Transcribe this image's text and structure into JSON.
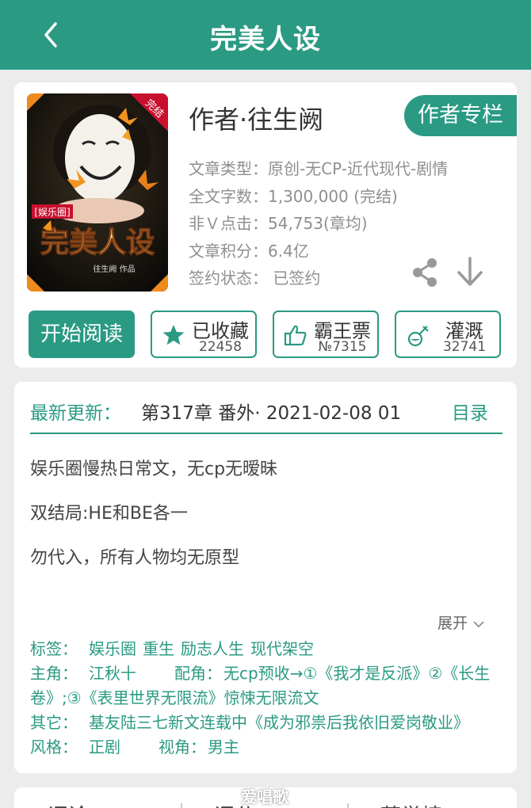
{
  "header": {
    "back_icon": "chevron-left-icon",
    "title": "完美人设"
  },
  "colors": {
    "accent": "#2a9a83",
    "background": "#ececec"
  },
  "book": {
    "cover": {
      "badge": "完结",
      "tag": "[娱乐圈]",
      "title_art": "完美人设",
      "author_line": "往生阙 作品"
    },
    "author": "作者·往生阙",
    "author_column_button": "作者专栏",
    "meta": [
      "文章类型：原创-无CP-近代现代-剧情",
      "全文字数：1,300,000 (完结)",
      "非Ｖ点击：54,753(章均)",
      "文章积分：6.4亿",
      "签约状态：  已签约"
    ],
    "share_icon": "share-icon",
    "download_icon": "download-icon"
  },
  "actions": {
    "read_button": "开始阅读",
    "favorite": {
      "icon": "star-icon",
      "label": "已收藏",
      "count": "22458"
    },
    "bawang": {
      "icon": "thumbs-up-icon",
      "label": "霸王票",
      "count": "№7315"
    },
    "irrigate": {
      "icon": "watering-icon",
      "label": "灌溉",
      "count": "32741"
    }
  },
  "update": {
    "label": "最新更新：",
    "text": "第317章  番外·  2021-02-08 01",
    "toc_link": "目录"
  },
  "description": [
    "娱乐圈慢热日常文，无cp无暧昧",
    "双结局:HE和BE各一",
    "勿代入，所有人物均无原型"
  ],
  "expand": "展开",
  "tags": {
    "label": "标签：",
    "items": [
      "娱乐圈",
      "重生",
      "励志人生",
      "现代架空"
    ]
  },
  "roles": {
    "main_label": "主角：",
    "main": "江秋十",
    "support_label": "配角：",
    "support": "无cp预收→①《我才是反派》②《长生卷》;③《表里世界无限流》惊悚无限流文"
  },
  "other": {
    "label": "其它：",
    "text": "基友陆三七新文连载中《成为邪祟后我依旧爱岗敬业》"
  },
  "style": {
    "label": "风格：",
    "value": "正剧",
    "view_label": "视角：",
    "view": "男主"
  },
  "bottom_tabs": [
    "评论",
    "评分",
    "荐举榜"
  ],
  "watermark": "爱唱歌"
}
